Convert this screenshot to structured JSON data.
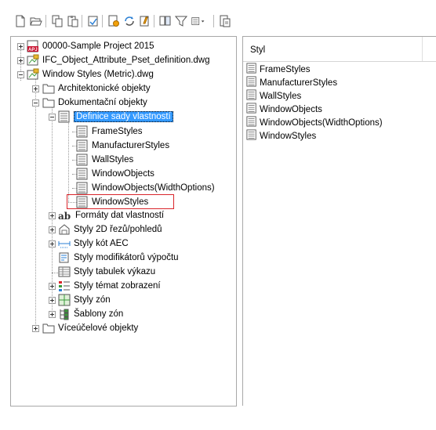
{
  "toolbar": {
    "buttons": [
      "new-icon",
      "open-icon",
      "copy-icon",
      "paste-icon",
      "purge-icon",
      "import-export-icon",
      "edit-icon",
      "edit-definition-icon",
      "filter-icon",
      "view-dropdown-icon",
      "synchronize-icon"
    ]
  },
  "tree": {
    "items": [
      {
        "label": "00000-Sample Project 2015"
      },
      {
        "label": "IFC_Object_Attribute_Pset_definition.dwg"
      },
      {
        "label": "Window Styles (Metric).dwg"
      },
      {
        "label": "Architektonické objekty"
      },
      {
        "label": "Dokumentační objekty"
      },
      {
        "label": "Definice sady vlastností"
      },
      {
        "label": "FrameStyles"
      },
      {
        "label": "ManufacturerStyles"
      },
      {
        "label": "WallStyles"
      },
      {
        "label": "WindowObjects"
      },
      {
        "label": "WindowObjects(WidthOptions)"
      },
      {
        "label": "WindowStyles"
      },
      {
        "label": "Formáty dat vlastností"
      },
      {
        "label": "Styly 2D řezů/pohledů"
      },
      {
        "label": "Styly kót AEC"
      },
      {
        "label": "Styly modifikátorů výpočtu"
      },
      {
        "label": "Styly tabulek výkazu"
      },
      {
        "label": "Styly témat zobrazení"
      },
      {
        "label": "Styly zón"
      },
      {
        "label": "Šablony zón"
      },
      {
        "label": "Víceúčelové objekty"
      }
    ]
  },
  "list": {
    "column_header": "Styl",
    "rows": [
      "FrameStyles",
      "ManufacturerStyles",
      "WallStyles",
      "WindowObjects",
      "WindowObjects(WidthOptions)",
      "WindowStyles"
    ]
  },
  "colors": {
    "selection": "#3399ff",
    "highlight_box": "#d9252b"
  }
}
